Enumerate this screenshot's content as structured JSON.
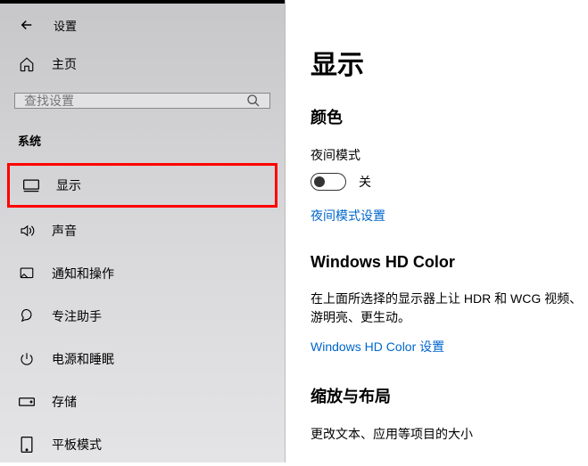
{
  "header": {
    "settings": "设置"
  },
  "home": {
    "label": "主页"
  },
  "search": {
    "placeholder": "查找设置"
  },
  "section": "系统",
  "nav": {
    "display": "显示",
    "sound": "声音",
    "notifications": "通知和操作",
    "focus": "专注助手",
    "power": "电源和睡眠",
    "storage": "存储",
    "tablet": "平板模式"
  },
  "main": {
    "title": "显示",
    "color_section": "颜色",
    "night_light_label": "夜间模式",
    "night_light_state": "关",
    "night_light_link": "夜间模式设置",
    "hd_color_title": "Windows HD Color",
    "hd_color_desc": "在上面所选择的显示器上让 HDR 和 WCG 视频、游明亮、更生动。",
    "hd_color_link": "Windows HD Color 设置",
    "scale_title": "缩放与布局",
    "scale_desc": "更改文本、应用等项目的大小"
  }
}
